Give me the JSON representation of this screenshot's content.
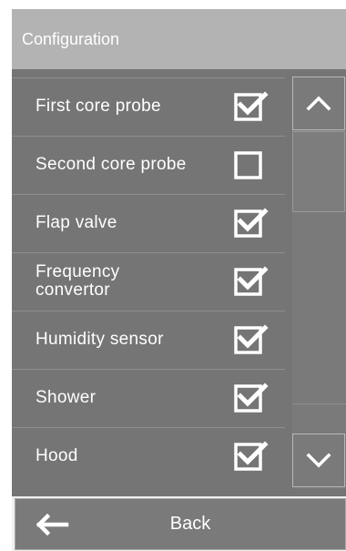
{
  "header": {
    "title": "Configuration"
  },
  "items": [
    {
      "label": "First core probe",
      "checked": true
    },
    {
      "label": "Second core probe",
      "checked": false
    },
    {
      "label": "Flap valve",
      "checked": true
    },
    {
      "label": "Frequency\nconvertor",
      "checked": true
    },
    {
      "label": "Humidity sensor",
      "checked": true
    },
    {
      "label": "Shower",
      "checked": true
    },
    {
      "label": "Hood",
      "checked": true
    }
  ],
  "scroll": {
    "up_icon": "chevron-up-icon",
    "down_icon": "chevron-down-icon"
  },
  "footer": {
    "back_label": "Back",
    "back_icon": "arrow-left-icon"
  },
  "colors": {
    "panel": "#757575",
    "header": "#b3b3b3",
    "text": "#ffffff"
  }
}
